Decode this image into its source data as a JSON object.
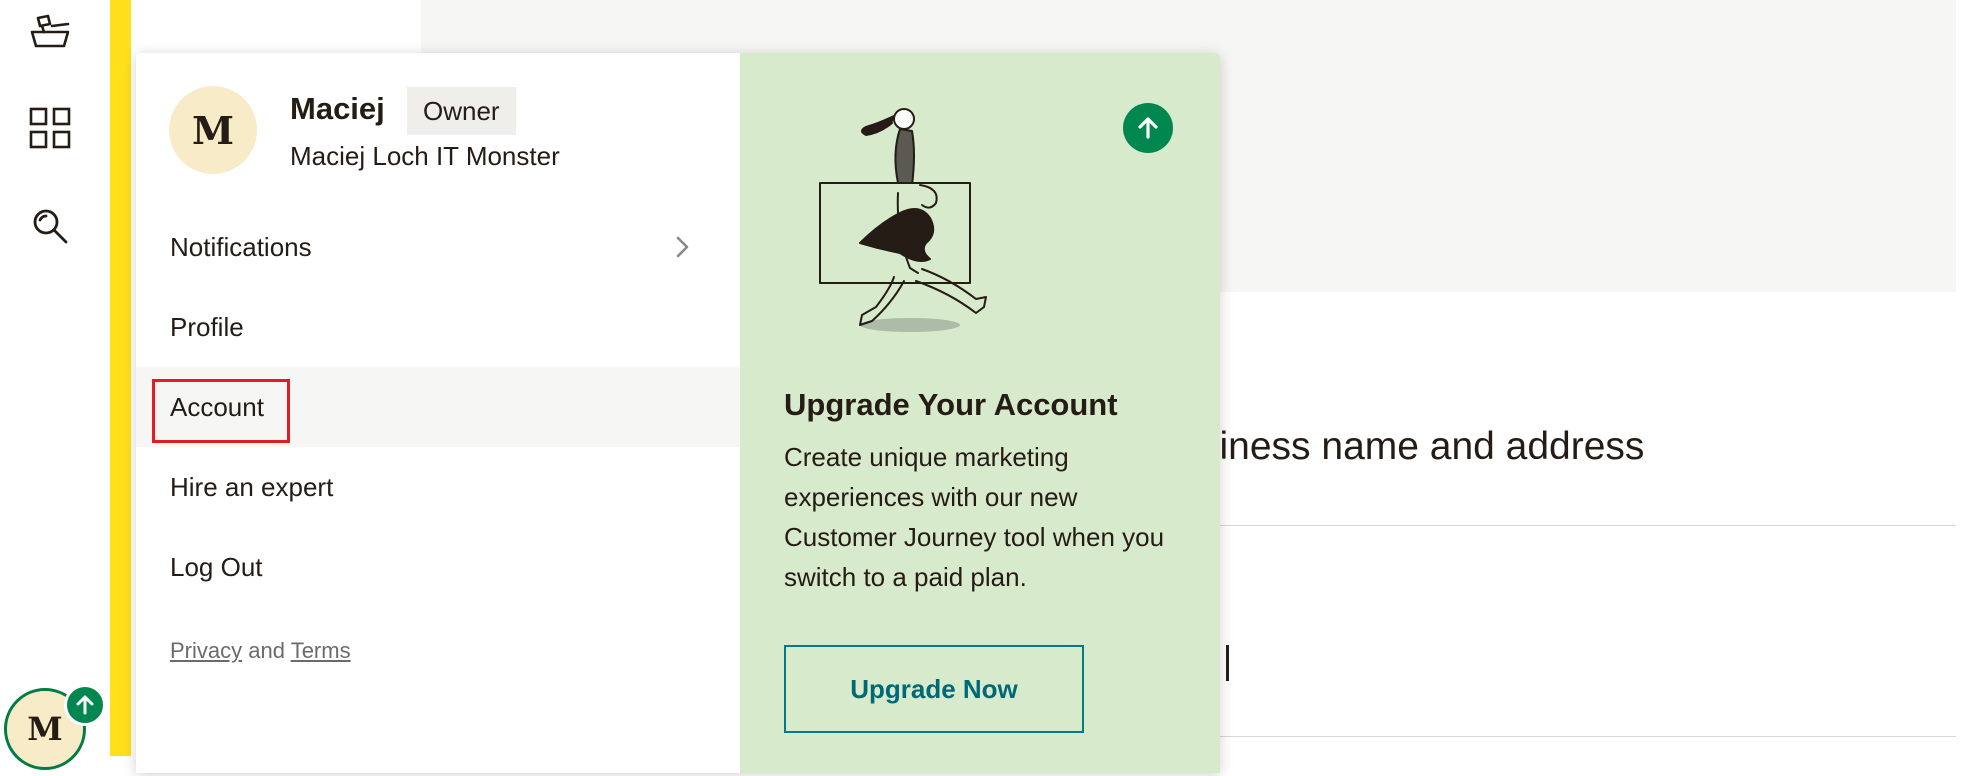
{
  "rail": {
    "icons": [
      "campaigns-icon",
      "grid-icon",
      "search-icon"
    ],
    "avatar_initial": "M"
  },
  "background": {
    "heading_fragment": "siness name and address"
  },
  "dropdown": {
    "user": {
      "initial": "M",
      "name": "Maciej",
      "role": "Owner",
      "organization": "Maciej Loch IT Monster"
    },
    "menu": [
      {
        "label": "Notifications",
        "has_submenu": true
      },
      {
        "label": "Profile"
      },
      {
        "label": "Account",
        "hovered": true,
        "highlighted": true
      },
      {
        "label": "Hire an expert"
      },
      {
        "label": "Log Out"
      }
    ],
    "footer": {
      "privacy": "Privacy",
      "and": "and",
      "terms": "Terms"
    },
    "promo": {
      "title": "Upgrade Your Account",
      "body": "Create unique marketing experiences with our new Customer Journey tool when you switch to a paid plan.",
      "button": "Upgrade Now",
      "badge_icon": "arrow-up-icon",
      "background_color": "#d8eacc",
      "accent_color": "#00864f"
    }
  },
  "colors": {
    "brand_yellow": "#ffe01b",
    "highlight_red": "#e31b23",
    "button_teal": "#007c89"
  }
}
